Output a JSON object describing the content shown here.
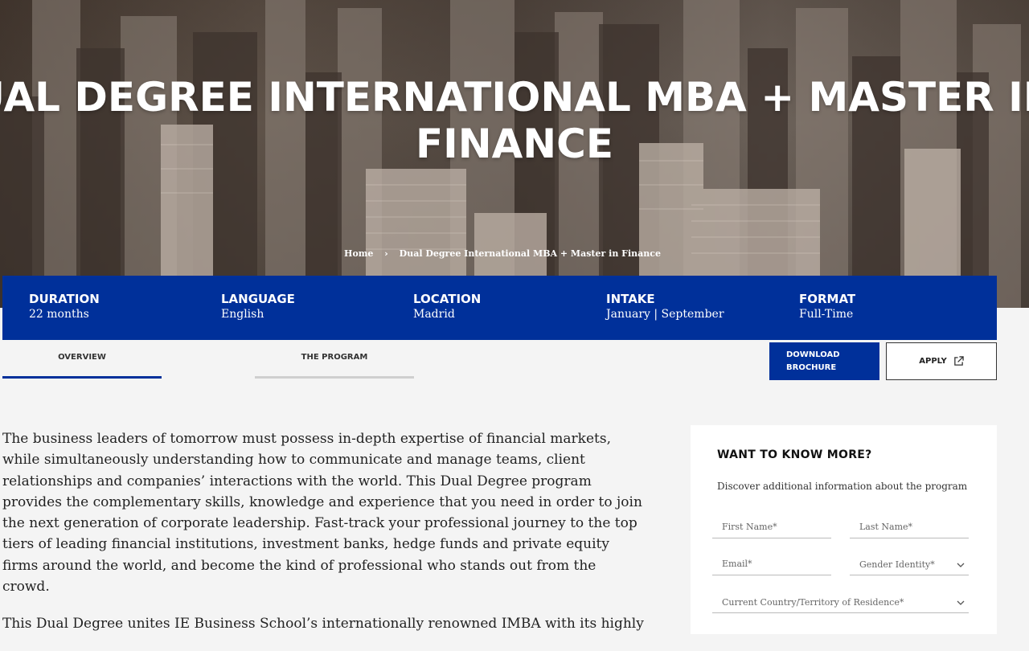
{
  "hero": {
    "title_line1": "UAL DEGREE INTERNATIONAL MBA + MASTER IN",
    "title_line2": "FINANCE",
    "breadcrumb": {
      "home": "Home",
      "current": "Dual Degree International MBA + Master in Finance"
    }
  },
  "info": [
    {
      "label": "DURATION",
      "value": "22 months"
    },
    {
      "label": "LANGUAGE",
      "value": "English"
    },
    {
      "label": "LOCATION",
      "value": "Madrid"
    },
    {
      "label": "INTAKE",
      "value": "January | September"
    },
    {
      "label": "FORMAT",
      "value": "Full-Time"
    }
  ],
  "tabs": {
    "overview": "OVERVIEW",
    "program": "THE PROGRAM"
  },
  "buttons": {
    "download": "DOWNLOAD BROCHURE",
    "apply": "APPLY"
  },
  "content": {
    "paragraph1": "The business leaders of tomorrow must possess in-depth expertise of financial markets, while simultaneously understanding how to communicate and manage teams, client relationships and companies’ interactions with the world. This Dual Degree program provides the complementary skills, knowledge and experience that you need in order to join the next generation of corporate leadership. Fast-track your professional journey to the top tiers of leading financial institutions, investment banks, hedge funds and private equity firms around the world, and become the kind of professional who stands out from the crowd.",
    "paragraph2": "This Dual Degree unites IE Business School’s internationally renowned IMBA with its highly"
  },
  "form": {
    "title": "WANT TO KNOW MORE?",
    "subtitle": "Discover additional information about the program",
    "first_name_placeholder": "First Name*",
    "last_name_placeholder": "Last Name*",
    "email_placeholder": "Email*",
    "gender_label": "Gender Identity*",
    "country_label": "Current Country/Territory of Residence*"
  },
  "colors": {
    "brand_blue": "#00309a"
  }
}
